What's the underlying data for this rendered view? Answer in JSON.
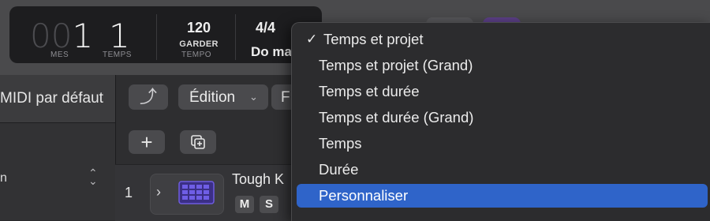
{
  "lcd": {
    "bars_dim": "00",
    "bars_value": "1",
    "beats_value": "1",
    "bars_caption": "MES",
    "beats_caption": "TEMPS",
    "tempo_value": "120",
    "tempo_mode": "GARDER",
    "tempo_caption": "TEMPO",
    "signature": "4/4",
    "key": "Do maj"
  },
  "left_panel": {
    "midi_label": "MIDI par défaut",
    "partial_label": "n",
    "stepper_icon": "up-down-chevron-icon"
  },
  "toolbar": {
    "up_icon": "⤴",
    "edit_label": "Édition",
    "edit_chevron": "⌄",
    "f_label": "F",
    "add_label": "+"
  },
  "track": {
    "number": "1",
    "expand_icon": "›",
    "name": "Tough K",
    "mute_label": "M",
    "solo_label": "S",
    "icon": "drum-machine-icon"
  },
  "menu": {
    "items": [
      {
        "label": "Temps et projet",
        "checked": true
      },
      {
        "label": "Temps et projet (Grand)",
        "checked": false
      },
      {
        "label": "Temps et durée",
        "checked": false
      },
      {
        "label": "Temps et durée (Grand)",
        "checked": false
      },
      {
        "label": "Temps",
        "checked": false
      },
      {
        "label": "Durée",
        "checked": false
      },
      {
        "label": "Personnaliser",
        "checked": false,
        "highlighted": true
      }
    ],
    "check_glyph": "✓",
    "highlight_color": "#2f64c9"
  }
}
